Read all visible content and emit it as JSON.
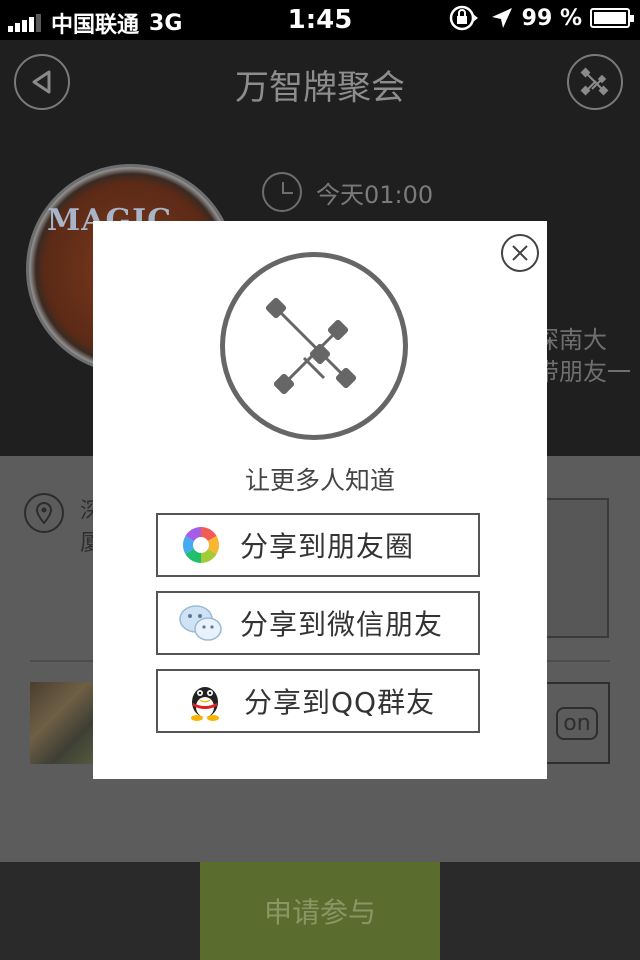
{
  "status_bar": {
    "carrier": "中国联通",
    "network": "3G",
    "time": "1:45",
    "battery_percent": "99 %",
    "battery_level": 0.99
  },
  "nav": {
    "title": "万智牌聚会",
    "back_icon": "back-arrow-icon",
    "share_icon": "share-graph-icon"
  },
  "event": {
    "logo_text": "MAGIC",
    "time": "今天01:00",
    "description_fragment_line1": "深南大",
    "description_fragment_line2": "带朋友一"
  },
  "location": {
    "address_line1": "深",
    "address_line2": "厦"
  },
  "checkin_badge": "on",
  "apply_button": "申请参与",
  "share_dialog": {
    "caption": "让更多人知道",
    "options": [
      {
        "label": "分享到朋友圈",
        "icon": "moments-icon"
      },
      {
        "label": "分享到微信朋友",
        "icon": "wechat-icon"
      },
      {
        "label": "分享到QQ群友",
        "icon": "qq-icon"
      }
    ]
  },
  "colors": {
    "apply_button_bg": "#5a6d2e",
    "nav_bg": "#1f1f1f",
    "dialog_bg": "#ffffff"
  }
}
